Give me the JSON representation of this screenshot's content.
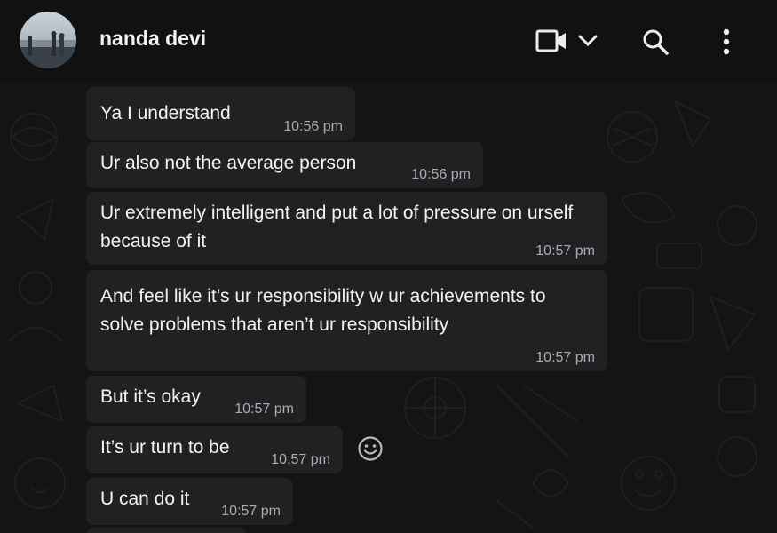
{
  "header": {
    "contact_name": "nanda devi",
    "icons": [
      "video-call-icon",
      "chevron-down-icon",
      "search-icon",
      "more-options-icon"
    ]
  },
  "messages": [
    {
      "text": "Ya I understand",
      "time": "10:56 pm"
    },
    {
      "text": "Ur also not the average person",
      "time": "10:56 pm"
    },
    {
      "text": "Ur extremely intelligent and put a lot of pressure on urself because of it",
      "time": "10:57 pm"
    },
    {
      "text": "And feel like it’s ur responsibility w ur achievements to solve problems that aren’t ur responsibility",
      "time": "10:57 pm"
    },
    {
      "text": "But it’s okay",
      "time": "10:57 pm"
    },
    {
      "text": "It’s ur turn to be",
      "time": "10:57 pm"
    },
    {
      "text": "U can do it",
      "time": "10:57 pm"
    }
  ],
  "reaction_icon": "smiley-reaction-icon",
  "colors": {
    "header_bg": "#111111",
    "bubble_bg": "#202123",
    "chat_bg": "#141414",
    "time_text": "#a9adb1"
  }
}
